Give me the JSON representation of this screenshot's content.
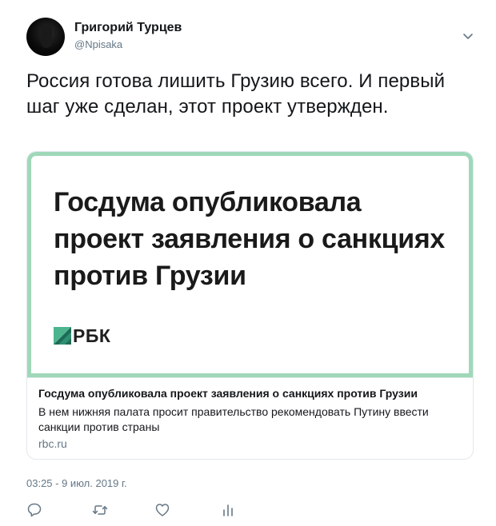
{
  "author": {
    "name": "Григорий Турцев",
    "handle": "@Npisaka"
  },
  "tweet": {
    "text": "Россия готова лишить Грузию всего. И первый шаг уже сделан, этот проект утвержден."
  },
  "card": {
    "image_headline": "Госдума опубликовала проект заявления о санкциях против Грузии",
    "logo_text": "РБК",
    "title": "Госдума опубликовала проект заявления о санкциях против Грузии",
    "description": "В нем нижняя палата просит правительство рекомендовать Путину ввести санкции против страны",
    "domain": "rbc.ru"
  },
  "timestamp": "03:25 - 9 июл. 2019 г.",
  "icons": {
    "menu": "chevron-down-icon",
    "reply": "reply-icon",
    "retweet": "retweet-icon",
    "like": "like-icon",
    "analytics": "analytics-icon"
  },
  "colors": {
    "card_frame": "#9fd8b9",
    "secondary_text": "#657786",
    "rbc_mark_dark": "#1d6b56",
    "rbc_mark_light": "#4cb58f"
  }
}
